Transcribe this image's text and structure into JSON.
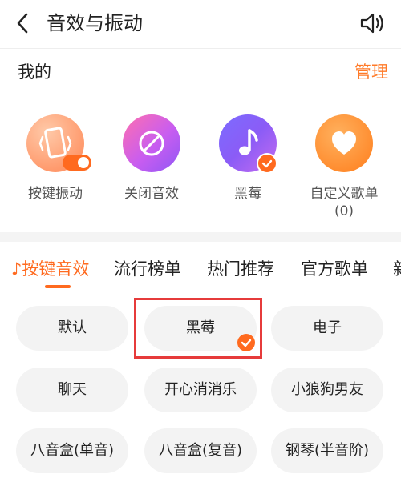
{
  "header": {
    "title": "音效与振动",
    "back_icon": "chevron-left-icon",
    "sound_icon": "speaker-icon"
  },
  "mine": {
    "heading": "我的",
    "manage_label": "管理",
    "items": [
      {
        "label": "按键振动",
        "icon": "phone-vibrate-icon",
        "toggle_on": true
      },
      {
        "label": "关闭音效",
        "icon": "mute-circle-icon"
      },
      {
        "label": "黑莓",
        "icon": "music-note-icon",
        "selected": true
      },
      {
        "label": "自定义歌单",
        "label2": "(0)",
        "icon": "heart-icon"
      }
    ]
  },
  "tabs": [
    {
      "label": "按键音效",
      "active": true,
      "prefix_icon": "music-note-small-icon"
    },
    {
      "label": "流行榜单"
    },
    {
      "label": "热门推荐"
    },
    {
      "label": "官方歌单"
    },
    {
      "label": "新"
    }
  ],
  "sounds": [
    {
      "label": "默认"
    },
    {
      "label": "黑莓",
      "selected": true
    },
    {
      "label": "电子"
    },
    {
      "label": "聊天"
    },
    {
      "label": "开心消消乐"
    },
    {
      "label": "小狼狗男友"
    },
    {
      "label": "八音盒(单音)"
    },
    {
      "label": "八音盒(复音)"
    },
    {
      "label": "钢琴(半音阶)"
    }
  ],
  "colors": {
    "accent": "#ff6a1f",
    "highlight": "#e63b3b",
    "pill_bg": "#f3f3f3"
  }
}
